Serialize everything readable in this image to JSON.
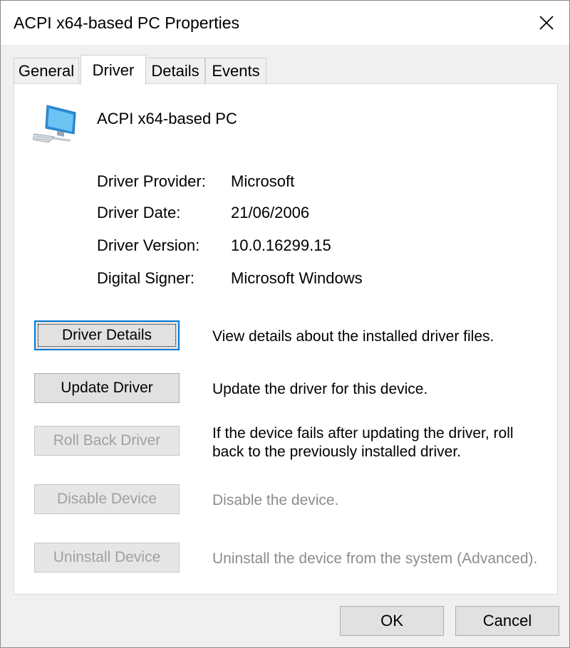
{
  "window": {
    "title": "ACPI x64-based PC Properties"
  },
  "tabs": [
    {
      "label": "General"
    },
    {
      "label": "Driver"
    },
    {
      "label": "Details"
    },
    {
      "label": "Events"
    }
  ],
  "device": {
    "name": "ACPI x64-based PC",
    "icon": "computer-monitor-icon"
  },
  "driver_info": [
    {
      "label": "Driver Provider:",
      "value": "Microsoft"
    },
    {
      "label": "Driver Date:",
      "value": "21/06/2006"
    },
    {
      "label": "Driver Version:",
      "value": "10.0.16299.15"
    },
    {
      "label": "Digital Signer:",
      "value": "Microsoft Windows"
    }
  ],
  "actions": [
    {
      "label": "Driver Details",
      "description": "View details about the installed driver files.",
      "enabled": true
    },
    {
      "label": "Update Driver",
      "description": "Update the driver for this device.",
      "enabled": true
    },
    {
      "label": "Roll Back Driver",
      "description": "If the device fails after updating the driver, roll back to the previously installed driver.",
      "enabled": false
    },
    {
      "label": "Disable Device",
      "description": "Disable the device.",
      "enabled": false
    },
    {
      "label": "Uninstall Device",
      "description": "Uninstall the device from the system (Advanced).",
      "enabled": false
    }
  ],
  "footer": {
    "ok_label": "OK",
    "cancel_label": "Cancel"
  },
  "colors": {
    "focus_border": "#0078d7",
    "disabled_text": "#a0a0a0"
  }
}
